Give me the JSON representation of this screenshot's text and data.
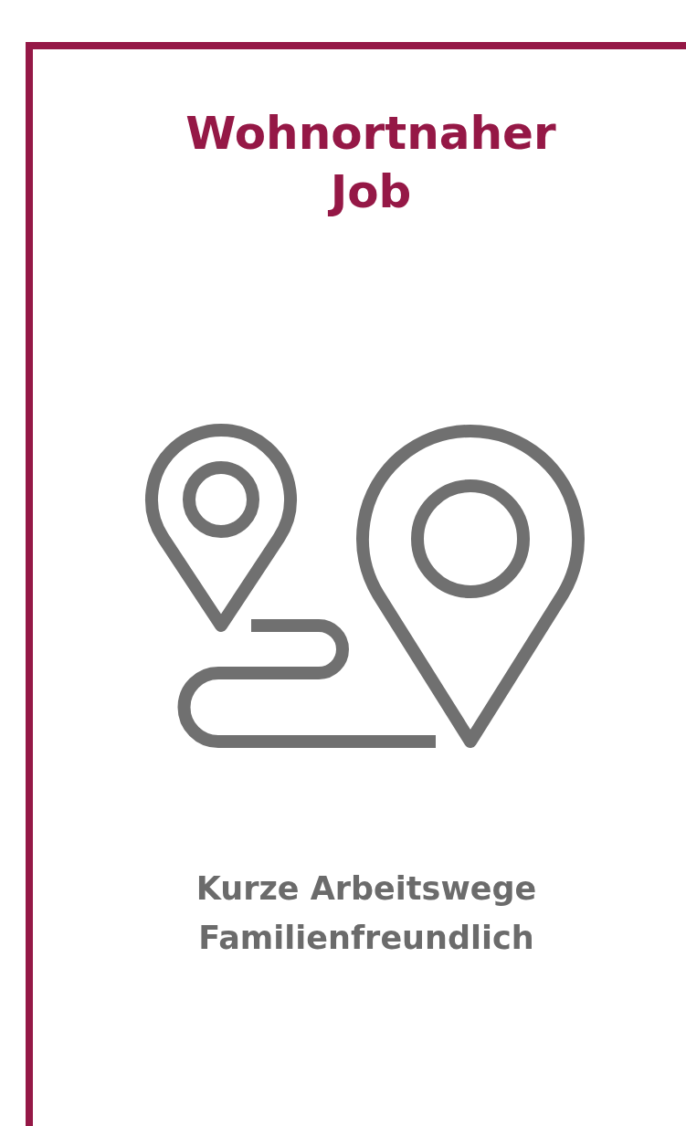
{
  "card": {
    "title": "Wohnortnaher Job",
    "benefits": [
      "Kurze Arbeitswege",
      "Familienfreundlich"
    ]
  }
}
